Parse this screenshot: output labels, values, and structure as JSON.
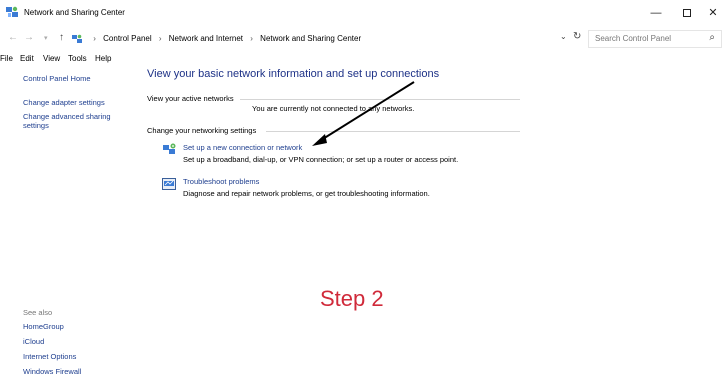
{
  "window": {
    "title": "Network and Sharing Center",
    "minimize": "—",
    "close": "✕"
  },
  "address": {
    "crumbs": [
      "Control Panel",
      "Network and Internet",
      "Network and Sharing Center"
    ],
    "search_placeholder": "Search Control Panel"
  },
  "menu": [
    "File",
    "Edit",
    "View",
    "Tools",
    "Help"
  ],
  "sidebar": {
    "items": [
      {
        "label": "Control Panel Home"
      },
      {
        "label": "Change adapter settings"
      },
      {
        "label": "Change advanced sharing settings"
      }
    ],
    "see_also_heading": "See also",
    "see_also": [
      {
        "label": "HomeGroup"
      },
      {
        "label": "iCloud"
      },
      {
        "label": "Internet Options"
      },
      {
        "label": "Windows Firewall"
      }
    ]
  },
  "main": {
    "title": "View your basic network information and set up connections",
    "active_networks_label": "View your active networks",
    "not_connected_text": "You are currently not connected to any networks.",
    "change_settings_label": "Change your networking settings",
    "tasks": [
      {
        "link": "Set up a new connection or network",
        "description": "Set up a broadband, dial-up, or VPN connection; or set up a router or access point.",
        "icon": "new-connection-icon"
      },
      {
        "link": "Troubleshoot problems",
        "description": "Diagnose and repair network problems, or get troubleshooting information.",
        "icon": "troubleshoot-icon"
      }
    ]
  },
  "annotation": {
    "step_label": "Step 2",
    "color": "#d02a3a"
  },
  "colors": {
    "link": "#1f3f8f",
    "heading": "#1e3287"
  }
}
